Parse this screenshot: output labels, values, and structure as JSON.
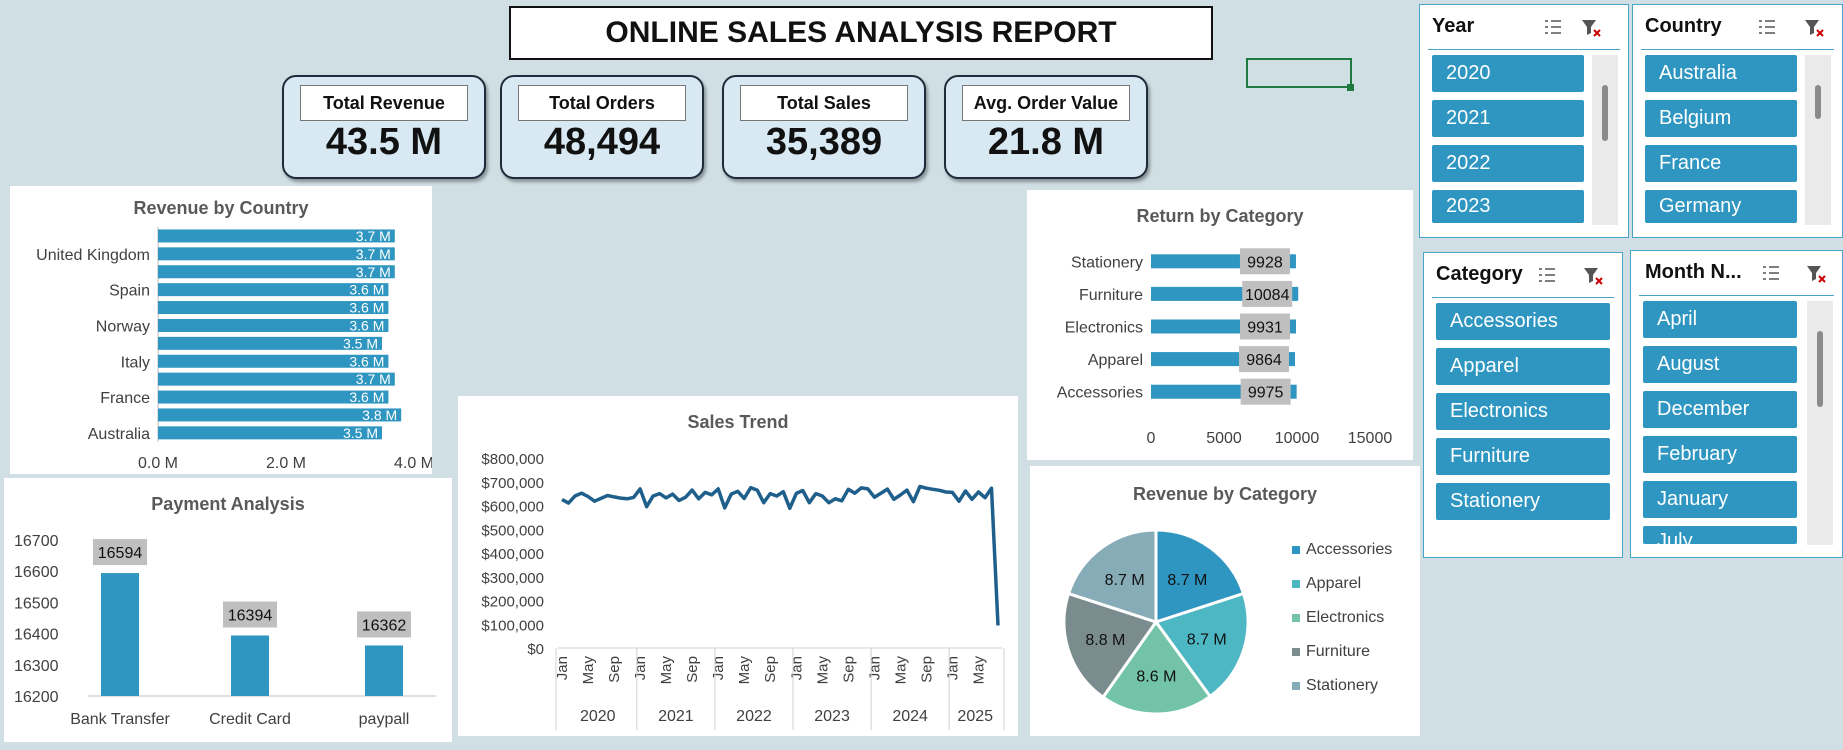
{
  "report_title": "ONLINE SALES ANALYSIS REPORT",
  "kpis": [
    {
      "label": "Total Revenue",
      "value": "43.5 M"
    },
    {
      "label": "Total Orders",
      "value": "48,494"
    },
    {
      "label": "Total Sales",
      "value": "35,389"
    },
    {
      "label": "Avg. Order Value",
      "value": "21.8 M"
    }
  ],
  "slicers": {
    "year": {
      "title": "Year",
      "items": [
        "2020",
        "2021",
        "2022",
        "2023"
      ]
    },
    "country": {
      "title": "Country",
      "items": [
        "Australia",
        "Belgium",
        "France",
        "Germany"
      ]
    },
    "category": {
      "title": "Category",
      "items": [
        "Accessories",
        "Apparel",
        "Electronics",
        "Furniture",
        "Stationery"
      ]
    },
    "month": {
      "title": "Month N...",
      "items": [
        "April",
        "August",
        "December",
        "February",
        "January",
        "July"
      ]
    }
  },
  "colors": {
    "accent": "#2e96c0",
    "line": "#1f5f8b",
    "pie": [
      "#2e96c0",
      "#4db7c4",
      "#72c3a8",
      "#7a8c8e",
      "#86acb8"
    ]
  },
  "chart_data": [
    {
      "id": "revenue_by_country",
      "type": "bar",
      "orientation": "horizontal",
      "title": "Revenue by Country",
      "categories": [
        "Australia",
        "",
        "France",
        "",
        "Italy",
        "",
        "Norway",
        "",
        "Spain",
        "",
        "United Kingdom",
        ""
      ],
      "values": [
        3.5,
        3.8,
        3.6,
        3.7,
        3.6,
        3.5,
        3.6,
        3.6,
        3.6,
        3.7,
        3.7,
        3.7
      ],
      "data_labels": [
        "3.5 M",
        "3.8 M",
        "3.6 M",
        "3.7 M",
        "3.6 M",
        "3.5 M",
        "3.6 M",
        "3.6 M",
        "3.6 M",
        "3.7 M",
        "3.7 M",
        "3.7 M"
      ],
      "xlim": [
        0,
        4
      ],
      "xticks": [
        "0.0 M",
        "2.0 M",
        "4.0 M"
      ]
    },
    {
      "id": "payment_analysis",
      "type": "bar",
      "title": "Payment Analysis",
      "categories": [
        "Bank Transfer",
        "Credit Card",
        "paypall"
      ],
      "values": [
        16594,
        16394,
        16362
      ],
      "ylim": [
        16200,
        16700
      ],
      "yticks": [
        "16200",
        "16300",
        "16400",
        "16500",
        "16600",
        "16700"
      ]
    },
    {
      "id": "sales_trend",
      "type": "line",
      "title": "Sales Trend",
      "years": [
        "2020",
        "2021",
        "2022",
        "2023",
        "2024",
        "2025"
      ],
      "month_ticks": [
        "Jan",
        "May",
        "Sep"
      ],
      "values": [
        625000,
        610000,
        640000,
        652000,
        638000,
        618000,
        630000,
        642000,
        636000,
        631000,
        628000,
        634000,
        670000,
        595000,
        640000,
        650000,
        632000,
        648000,
        621000,
        635000,
        665000,
        628000,
        655000,
        645000,
        670000,
        590000,
        648000,
        660000,
        630000,
        675000,
        665000,
        612000,
        650000,
        640000,
        658000,
        588000,
        651000,
        663000,
        612000,
        650000,
        640000,
        612000,
        628000,
        620000,
        668000,
        652000,
        674000,
        670000,
        635000,
        652000,
        669000,
        626000,
        644000,
        665000,
        616000,
        680000,
        673000,
        668000,
        664000,
        657000,
        655000,
        618000,
        661000,
        626000,
        657000,
        633000,
        673000,
        95000
      ],
      "ylim": [
        0,
        800000
      ],
      "yticks": [
        "$0",
        "$100,000",
        "$200,000",
        "$300,000",
        "$400,000",
        "$500,000",
        "$600,000",
        "$700,000",
        "$800,000"
      ]
    },
    {
      "id": "return_by_category",
      "type": "bar",
      "orientation": "horizontal",
      "title": "Return by Category",
      "categories": [
        "Accessories",
        "Apparel",
        "Electronics",
        "Furniture",
        "Stationery"
      ],
      "values": [
        9975,
        9864,
        9931,
        10084,
        9928
      ],
      "xlim": [
        0,
        15000
      ],
      "xticks": [
        "0",
        "5000",
        "10000",
        "15000"
      ]
    },
    {
      "id": "revenue_by_category",
      "type": "pie",
      "title": "Revenue by Category",
      "categories": [
        "Accessories",
        "Apparel",
        "Electronics",
        "Furniture",
        "Stationery"
      ],
      "values": [
        8.7,
        8.7,
        8.6,
        8.8,
        8.7
      ],
      "data_labels": [
        "8.7 M",
        "8.7 M",
        "8.6 M",
        "8.8 M",
        "8.7 M"
      ],
      "legend": "right"
    }
  ]
}
